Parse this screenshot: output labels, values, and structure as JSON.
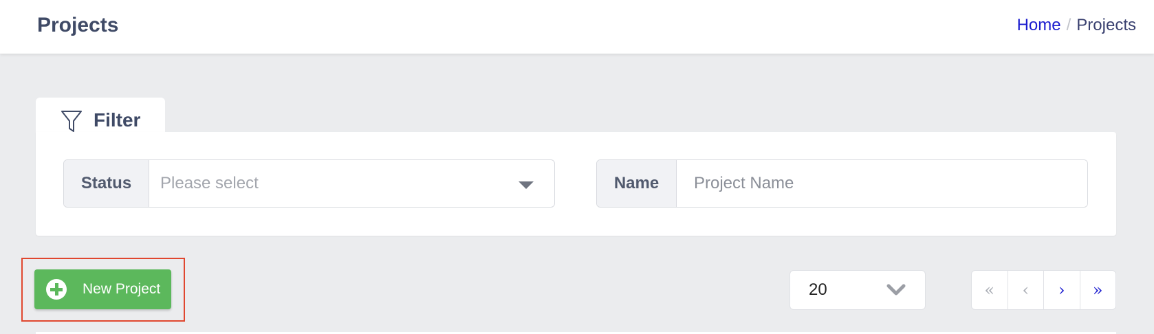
{
  "header": {
    "title": "Projects",
    "breadcrumb": {
      "home": "Home",
      "separator": "/",
      "current": "Projects"
    }
  },
  "filter": {
    "tab_label": "Filter",
    "status": {
      "label": "Status",
      "placeholder": "Please select"
    },
    "name": {
      "label": "Name",
      "placeholder": "Project Name",
      "value": ""
    }
  },
  "actions": {
    "new_project_label": "New Project"
  },
  "pagination": {
    "page_size": "20",
    "first": "«",
    "prev": "‹",
    "next": "›",
    "last": "»"
  },
  "colors": {
    "primary_link": "#1b1ccf",
    "success": "#5cb85c",
    "highlight": "#e0472f"
  }
}
